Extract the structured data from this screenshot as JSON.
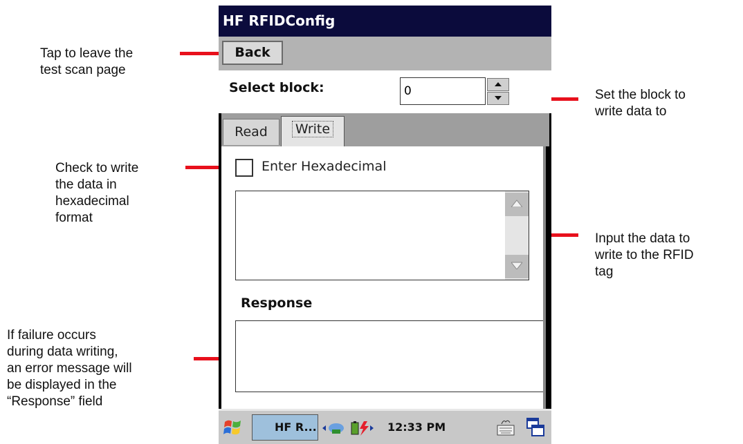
{
  "window": {
    "title": "HF RFIDConfig"
  },
  "menu": {
    "back_label": "Back"
  },
  "block": {
    "label": "Select block:",
    "value": "0"
  },
  "tabs": [
    {
      "label": "Read"
    },
    {
      "label": "Write"
    }
  ],
  "write_tab": {
    "hex_checkbox_label": "Enter Hexadecimal",
    "hex_checked": false,
    "data_value": "",
    "response_label": "Response",
    "response_value": ""
  },
  "taskbar": {
    "app_label": "HF R...",
    "clock": "12:33 PM"
  },
  "callouts": {
    "back": [
      "Tap to leave the",
      "test scan page"
    ],
    "block": [
      "Set the block to",
      "write data to"
    ],
    "hex": [
      "Check to write",
      "the data in",
      "hexadecimal",
      "format"
    ],
    "data": [
      "Input the data to",
      "write to the RFID",
      "tag"
    ],
    "response": [
      "If failure occurs",
      "during data writing,",
      "an error message will",
      "be displayed in the",
      "“Response” field"
    ]
  },
  "colors": {
    "callout_line": "#e8101c",
    "title_bar": "#0b0b3c"
  }
}
